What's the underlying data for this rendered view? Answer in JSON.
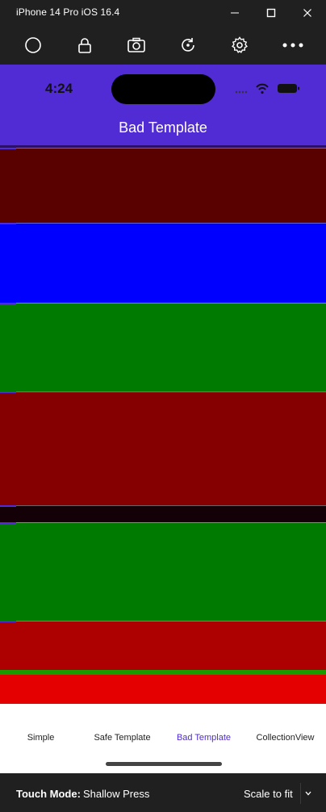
{
  "window": {
    "title": "iPhone 14 Pro iOS 16.4"
  },
  "toolbar": {
    "icons": [
      "home-circle-icon",
      "lock-icon",
      "camera-icon",
      "rotate-icon",
      "settings-gear-icon",
      "more-icon"
    ]
  },
  "status_bar": {
    "time": "4:24"
  },
  "nav": {
    "title": "Bad Template",
    "color": "#512bd4"
  },
  "rows_colors": [
    "#590000",
    "#0000ff",
    "#007a00",
    "#850000",
    "#140007",
    "#007a00",
    "#ad0000",
    "#1b9a00",
    "#e40000"
  ],
  "tabs": [
    {
      "label": "Simple"
    },
    {
      "label": "Safe Template"
    },
    {
      "label": "Bad Template"
    },
    {
      "label": "CollectionView"
    }
  ],
  "bottom": {
    "touch_mode_label": "Touch Mode:",
    "touch_mode_value": "Shallow Press",
    "scale_label": "Scale to fit"
  }
}
